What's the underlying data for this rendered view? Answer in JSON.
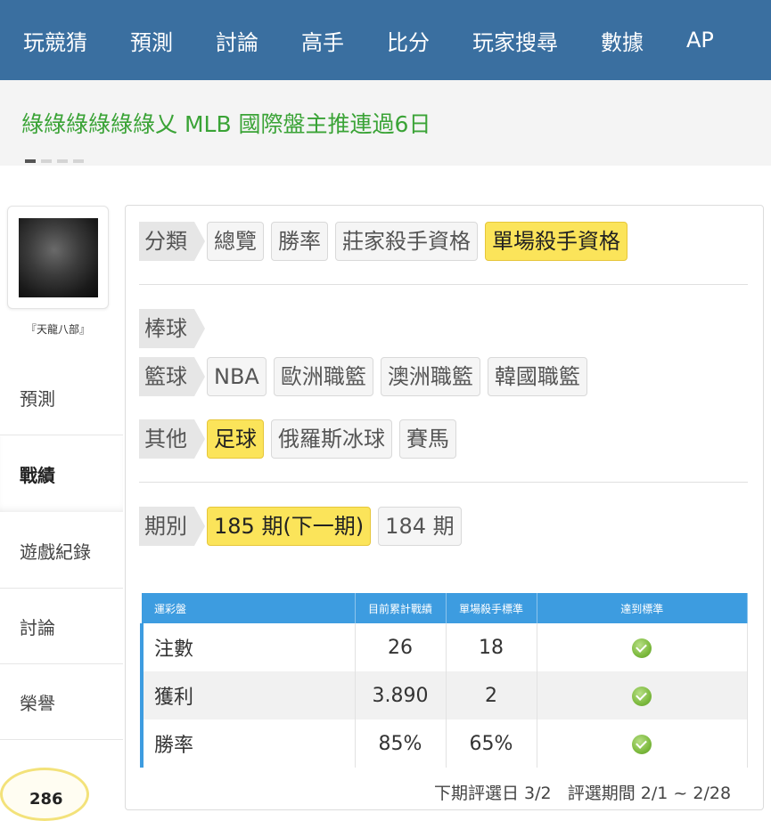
{
  "topnav": {
    "items": [
      "玩競猜",
      "預測",
      "討論",
      "高手",
      "比分",
      "玩家搜尋",
      "數據",
      "AP"
    ]
  },
  "headline": {
    "title": "綠綠綠綠綠綠乂 MLB 國際盤主推連過6日"
  },
  "profile": {
    "username": "『天龍八部』",
    "points": "286"
  },
  "sidebar": {
    "items": [
      {
        "label": "預測"
      },
      {
        "label": "戰績",
        "active": true
      },
      {
        "label": "遊戲紀錄"
      },
      {
        "label": "討論"
      },
      {
        "label": "榮譽"
      }
    ]
  },
  "filters": {
    "category": {
      "label": "分類",
      "options": [
        "總覽",
        "勝率",
        "莊家殺手資格",
        "單場殺手資格"
      ],
      "selected": "單場殺手資格"
    },
    "baseball": {
      "label": "棒球"
    },
    "basketball": {
      "label": "籃球",
      "options": [
        "NBA",
        "歐洲職籃",
        "澳洲職籃",
        "韓國職籃"
      ]
    },
    "other": {
      "label": "其他",
      "options": [
        "足球",
        "俄羅斯冰球",
        "賽馬"
      ],
      "selected": "足球"
    },
    "period": {
      "label": "期別",
      "options": [
        "185 期(下一期)",
        "184 期"
      ],
      "selected": "185 期(下一期)"
    }
  },
  "table": {
    "headers": [
      "運彩盤",
      "目前累計戰績",
      "單場殺手標準",
      "達到標準"
    ],
    "rows": [
      {
        "name": "注數",
        "current": "26",
        "standard": "18",
        "met": "check-icon"
      },
      {
        "name": "獲利",
        "current": "3.890",
        "standard": "2",
        "met": "check-icon"
      },
      {
        "name": "勝率",
        "current": "85%",
        "standard": "65%",
        "met": "check-icon"
      }
    ]
  },
  "footer": {
    "next_selection": "下期評選日 3/2",
    "period_range": "評選期間 2/1 ~ 2/28"
  },
  "colors": {
    "nav_bg": "#3a6fa0",
    "headline_text": "#3aa336",
    "selected_option": "#fbe45a",
    "table_header": "#3d9ce0"
  }
}
